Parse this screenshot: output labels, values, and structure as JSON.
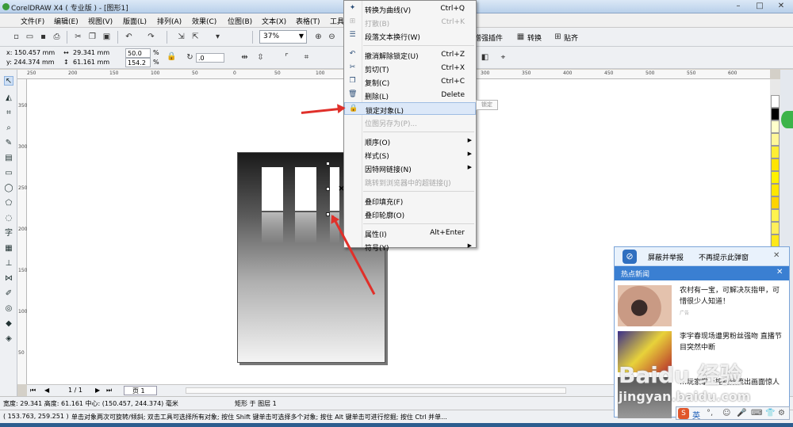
{
  "window": {
    "title": "CorelDRAW X4 ( 专业版 ) - [图形1]",
    "controls": [
      "–",
      "□",
      "✕"
    ]
  },
  "menubar": {
    "items": [
      "文件(F)",
      "编辑(E)",
      "视图(V)",
      "版面(L)",
      "排列(A)",
      "效果(C)",
      "位图(B)",
      "文本(X)",
      "表格(T)",
      "工具"
    ]
  },
  "toolbar": {
    "zoom": "37%",
    "plugins": [
      {
        "label": "增强插件"
      },
      {
        "label": "转换"
      },
      {
        "label": "贴齐"
      }
    ]
  },
  "property_bar": {
    "x": "x: 150.457 mm",
    "y": "y: 244.374 mm",
    "w": "29.341 mm",
    "h": "61.161 mm",
    "scale_x": "50.0",
    "scale_y": "154.2",
    "pct": "%",
    "angle": ".0"
  },
  "rulers": {
    "h_ticks": [
      "250",
      "200",
      "150",
      "100",
      "50",
      "0",
      "50",
      "100",
      "150",
      "200",
      "250",
      "300",
      "350",
      "400",
      "450",
      "500",
      "550",
      "600"
    ],
    "v_ticks": [
      "350",
      "300",
      "250",
      "200",
      "150",
      "100",
      "50"
    ]
  },
  "context_menu": {
    "items": [
      {
        "label": "转换为曲线(V)",
        "shortcut": "Ctrl+Q",
        "icon": "convert-curve-icon",
        "glyph": "✦",
        "disabled": false
      },
      {
        "label": "打散(B)",
        "shortcut": "Ctrl+K",
        "icon": "break-apart-icon",
        "glyph": "⊞",
        "disabled": true
      },
      {
        "label": "段落文本换行(W)",
        "shortcut": "",
        "icon": "text-wrap-icon",
        "glyph": "☰",
        "disabled": false
      },
      {
        "sep": true
      },
      {
        "label": "撤消解除锁定(U)",
        "shortcut": "Ctrl+Z",
        "icon": "undo-icon",
        "glyph": "↶",
        "disabled": false
      },
      {
        "label": "剪切(T)",
        "shortcut": "Ctrl+X",
        "icon": "scissors-icon",
        "glyph": "✂",
        "disabled": false
      },
      {
        "label": "复制(C)",
        "shortcut": "Ctrl+C",
        "icon": "copy-icon",
        "glyph": "❐",
        "disabled": false
      },
      {
        "label": "删除(L)",
        "shortcut": "Delete",
        "icon": "trash-icon",
        "glyph": "🗑",
        "disabled": false
      },
      {
        "label": "锁定对象(L)",
        "shortcut": "",
        "icon": "lock-icon",
        "glyph": "🔒",
        "disabled": false,
        "highlight": true
      },
      {
        "label": "位图另存为(P)...",
        "shortcut": "",
        "icon": "",
        "glyph": "",
        "disabled": true
      },
      {
        "sep": true
      },
      {
        "label": "顺序(O)",
        "shortcut": "",
        "icon": "",
        "glyph": "",
        "disabled": false,
        "submenu": true
      },
      {
        "label": "样式(S)",
        "shortcut": "",
        "icon": "",
        "glyph": "",
        "disabled": false,
        "submenu": true
      },
      {
        "label": "因特网链接(N)",
        "shortcut": "",
        "icon": "",
        "glyph": "",
        "disabled": false,
        "submenu": true
      },
      {
        "label": "跳转到浏览器中的超链接(J)",
        "shortcut": "",
        "icon": "",
        "glyph": "",
        "disabled": true
      },
      {
        "sep": true
      },
      {
        "label": "叠印填充(F)",
        "shortcut": "",
        "icon": "",
        "glyph": "",
        "disabled": false
      },
      {
        "label": "叠印轮廓(O)",
        "shortcut": "",
        "icon": "",
        "glyph": "",
        "disabled": false
      },
      {
        "sep": true
      },
      {
        "label": "属性(I)",
        "shortcut": "Alt+Enter",
        "icon": "",
        "glyph": "",
        "disabled": false
      },
      {
        "label": "符号(Y)",
        "shortcut": "",
        "icon": "",
        "glyph": "",
        "disabled": false,
        "submenu": true
      }
    ],
    "tooltip": "锁定"
  },
  "page_nav": {
    "counter": "1 / 1",
    "tab": "页 1"
  },
  "status": {
    "line1": "宽度: 29.341  高度: 61.161  中心: (150.457, 244.374)  毫米",
    "line1_mid": "矩形 于 图层 1",
    "coords": "( 153.763, 259.251 )",
    "hint": "单击对象两次可旋转/倾斜; 双击工具可选择所有对象; 按住 Shift 键单击可选择多个对象; 按住 Alt 键单击可进行挖掘; 按住 Ctrl 并单..."
  },
  "popup": {
    "report": "屏蔽并举报",
    "dismiss": "不再提示此弹窗",
    "header": "热点新闻",
    "news": [
      {
        "text": "农村有一宝，可解决灰指甲，可惜很少人知道！",
        "tag": "广告"
      },
      {
        "text": "李宇春现场遭男粉丝强吻 直播节目突然中断"
      },
      {
        "text": "…玩家掌上控视频流出画面惊人"
      }
    ],
    "close": "✕"
  },
  "watermark": {
    "brand": "Baidu 经验",
    "url": "jingyan.baidu.com"
  },
  "ime": {
    "lang": "英",
    "logo": "S"
  },
  "palette": [
    "#ffffff",
    "#000000",
    "#ffffcc",
    "#fff799",
    "#ffee33",
    "#ffe400",
    "#fff200",
    "#ffe600",
    "#ffd400",
    "#fff34d",
    "#ffef5a",
    "#ffe81a",
    "#fde400",
    "#ffea00",
    "#ffd800",
    "#ffe000",
    "#ffcc00",
    "#ffdd00",
    "#ffff66",
    "#fff799",
    "#ffff33",
    "#ffe900",
    "#ffd700",
    "#ffcc33"
  ],
  "accent": {
    "menu_highlight": "#dce8f8",
    "arrow": "#e0302a",
    "popup_header": "#3a7fd2"
  }
}
